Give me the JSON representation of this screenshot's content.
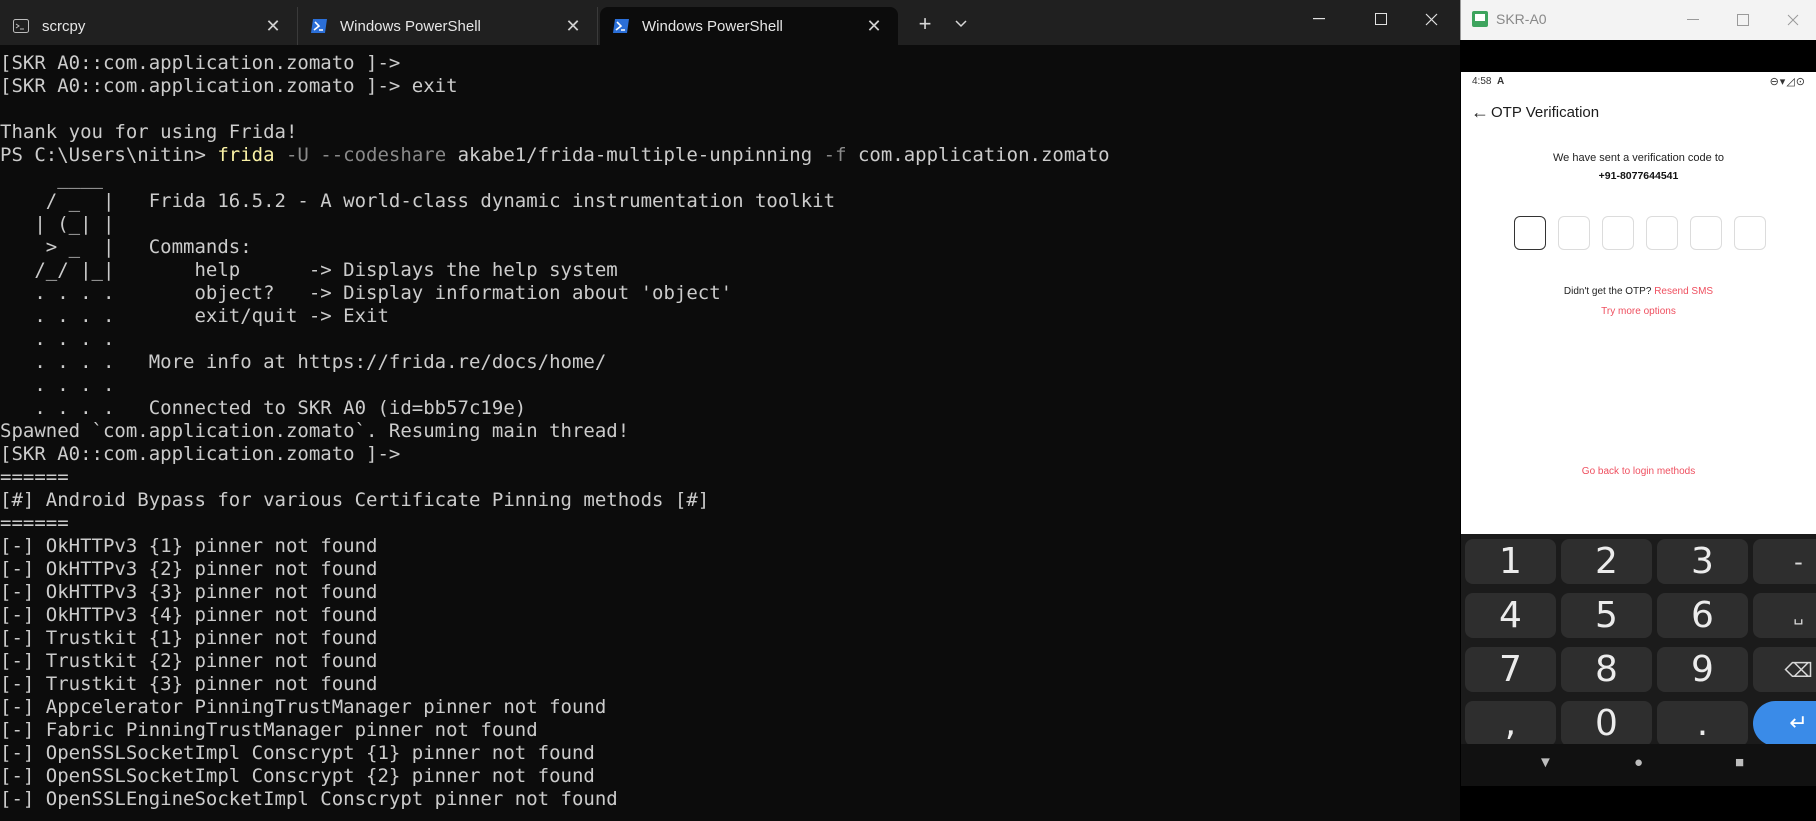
{
  "terminal": {
    "tabs": [
      {
        "label": "scrcpy",
        "icon": "terminal-icon",
        "active": false
      },
      {
        "label": "Windows PowerShell",
        "icon": "powershell-icon",
        "active": false
      },
      {
        "label": "Windows PowerShell",
        "icon": "powershell-icon",
        "active": true
      }
    ],
    "new_tab_label": "+",
    "dropdown_label": "⌄",
    "lines": [
      "[SKR A0::com.application.zomato ]->",
      "[SKR A0::com.application.zomato ]-> exit",
      "",
      "Thank you for using Frida!",
      "__CMD__",
      "     ____",
      "    / _  |   Frida 16.5.2 - A world-class dynamic instrumentation toolkit",
      "   | (_| |",
      "    > _  |   Commands:",
      "   /_/ |_|       help      -> Displays the help system",
      "   . . . .       object?   -> Display information about 'object'",
      "   . . . .       exit/quit -> Exit",
      "   . . . .",
      "   . . . .   More info at https://frida.re/docs/home/",
      "   . . . .",
      "   . . . .   Connected to SKR A0 (id=bb57c19e)",
      "Spawned `com.application.zomato`. Resuming main thread!",
      "[SKR A0::com.application.zomato ]->",
      "======",
      "[#] Android Bypass for various Certificate Pinning methods [#]",
      "======",
      "[-] OkHTTPv3 {1} pinner not found",
      "[-] OkHTTPv3 {2} pinner not found",
      "[-] OkHTTPv3 {3} pinner not found",
      "[-] OkHTTPv3 {4} pinner not found",
      "[-] Trustkit {1} pinner not found",
      "[-] Trustkit {2} pinner not found",
      "[-] Trustkit {3} pinner not found",
      "[-] Appcelerator PinningTrustManager pinner not found",
      "[-] Fabric PinningTrustManager pinner not found",
      "[-] OpenSSLSocketImpl Conscrypt {1} pinner not found",
      "[-] OpenSSLSocketImpl Conscrypt {2} pinner not found",
      "[-] OpenSSLEngineSocketImpl Conscrypt pinner not found"
    ],
    "command": {
      "prompt": "PS C:\\Users\\nitin> ",
      "exe": "frida",
      "flag1": " -U --codeshare ",
      "arg1": "akabe1/frida-multiple-unpinning",
      "flag2": " -f ",
      "arg2": "com.application.zomato"
    }
  },
  "scrcpy": {
    "window_title": "SKR-A0",
    "status_time": "4:58",
    "status_a": "A",
    "status_icons": "⊖▾◿⊙",
    "header_title": "OTP Verification",
    "sent_text": "We have sent a verification code to",
    "phone_number": "+91-8077644541",
    "otp_boxes": 6,
    "didnt_get": "Didn't get the OTP?",
    "resend": "Resend SMS",
    "try_more": "Try more options",
    "go_back": "Go back to login methods",
    "keys": [
      "1",
      "2",
      "3",
      "-",
      "4",
      "5",
      "6",
      "␣",
      "7",
      "8",
      "9",
      "⌫",
      ",",
      "0",
      ".",
      "↵"
    ],
    "nav": [
      "▼",
      "●",
      "■"
    ],
    "colors": {
      "accent_red": "#ef4f5f",
      "enter_blue": "#3a8be8"
    }
  }
}
